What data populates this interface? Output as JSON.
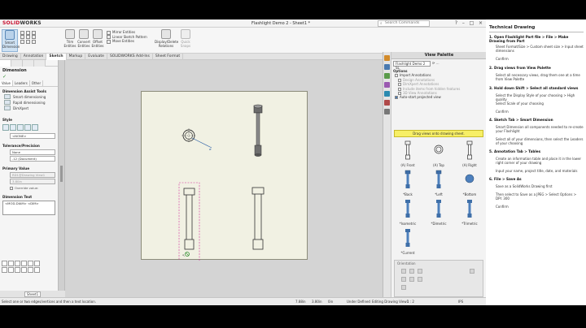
{
  "app": {
    "logo_solid": "SOLID",
    "logo_works": "WORKS",
    "document_title": "Flashlight Demo 2 - Sheet1 *",
    "search_placeholder": "Search Commands",
    "window_controls": [
      "?",
      "–",
      "□",
      "×"
    ]
  },
  "ribbon": {
    "large_buttons": [
      {
        "label": "Smart Dimension",
        "active": true
      },
      {
        "label": "Trim Entities"
      },
      {
        "label": "Convert Entities"
      },
      {
        "label": "Offset Entities"
      },
      {
        "label": "Mirror Entities"
      },
      {
        "label": "Linear Sketch Pattern"
      },
      {
        "label": "Move Entities"
      },
      {
        "label": "Display/Delete Relations"
      },
      {
        "label": "Quick Snaps"
      }
    ]
  },
  "tabs": [
    "Drawing",
    "Annotation",
    "Sketch",
    "Markup",
    "Evaluate",
    "SOLIDWORKS Add-Ins",
    "Sheet Format"
  ],
  "active_tab": "Sketch",
  "property_manager": {
    "title": "Dimension",
    "subtabs": [
      "Value",
      "Leaders",
      "Other"
    ],
    "assist_title": "Dimension Assist Tools",
    "assist_items": [
      "Smart dimensioning",
      "Rapid dimensioning",
      "DimXpert"
    ],
    "style_title": "Style",
    "style_value": "<NONE>",
    "tolerance_title": "Tolerance/Precision",
    "tolerance_value": "None",
    "precision_value": ".12 (Document)",
    "primary_title": "Primary Value",
    "primary_ref": "RD1@Drawing View1",
    "primary_value": "3.80in",
    "override_label": "Override value:",
    "dimtext_title": "Dimension Text",
    "dimtext_value": "<MOD-DIAM> <DIM>"
  },
  "view_palette": {
    "title": "View Palette",
    "selected_part": "Flashlight Demo 2 SL",
    "options_title": "Options",
    "import_annotations": "Import Annotations",
    "design_annotations": "Design Annotations",
    "dimxpert_annotations": "DimXpert Annotations",
    "hidden_features": "Include items from hidden features",
    "view_annotations": "3D View Annotations",
    "auto_start": "Auto-start projected view",
    "drag_hint": "Drag views onto drawing sheet.",
    "views": [
      "(A) Front",
      "(A) Top",
      "(A) Right",
      "*Back",
      "*Left",
      "*Bottom",
      "*Isometric",
      "*Dimetric",
      "*Trimetric",
      "*Current"
    ],
    "orientation_title": "Orientation"
  },
  "sheet_tab": "Sheet1",
  "status": {
    "message": "Select one or two edges/vertices and then a text location.",
    "x": "7.88in",
    "y": "3.80in",
    "z": "0in",
    "state": "Under Defined",
    "editing": "Editing Drawing View1",
    "scale": "1 : 2",
    "units": "IPS"
  },
  "instructions": {
    "title": "Technical Drawing",
    "steps": [
      {
        "text": "1. Open Flashlight Part file > File > Make Drawing from Part",
        "subs": [
          "Sheet Format/Size > Custom sheet size > Input sheet dimensions",
          "Confirm"
        ]
      },
      {
        "text": "2. Drag views from View Palette",
        "subs": [
          "Select all necessary views, drag them one at a time from View Palette"
        ]
      },
      {
        "text": "3. Hold down Shift > Select all standard views",
        "subs": [
          "Select the Display Style of your choosing > High quality",
          "Select Scale of your choosing",
          "Confirm"
        ]
      },
      {
        "text": "4. Sketch Tab > Smart Dimension",
        "subs": [
          "Smart Dimension all components needed to re-create your Flashlight",
          "Select all of your dimensions, then select the Leaders of your choosing"
        ]
      },
      {
        "text": "5. Annotation Tab > Tables",
        "subs": [
          "Create an information table and place it in the lower right corner of your drawing",
          "Input your name, project title, date, and materials"
        ]
      },
      {
        "text": "6. File > Save As",
        "subs": [
          "Save as a SolidWorks Drawing first",
          "Then select to Save as a JPEG > Select Options > DPI: 300",
          "Confirm"
        ]
      }
    ]
  },
  "colors": {
    "sheet": "#f1f1e3",
    "selection_magenta": "#d12b9a",
    "accent_blue": "#2b5fa7",
    "hint_yellow": "#f7ef66",
    "ok_green": "#2a8a2a"
  }
}
